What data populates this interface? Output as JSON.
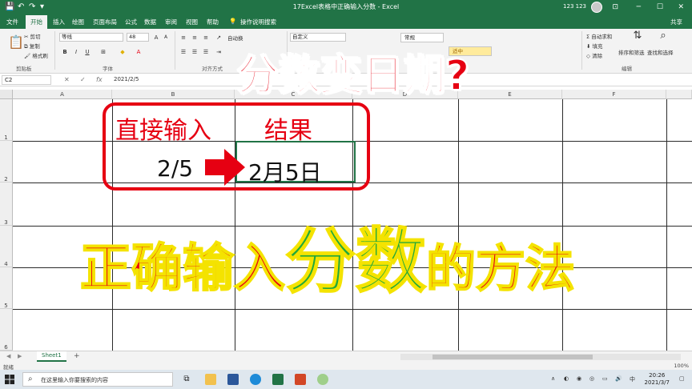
{
  "window": {
    "title": "17Excel表格中正确输入分数 - Excel",
    "user": "123 123"
  },
  "menu": {
    "tabs": [
      "文件",
      "开始",
      "插入",
      "绘图",
      "页面布局",
      "公式",
      "数据",
      "审阅",
      "视图",
      "帮助"
    ],
    "active": "开始",
    "tell_me": "操作说明搜索",
    "share": "共享"
  },
  "ribbon": {
    "clipboard": {
      "cut": "剪切",
      "copy": "复制",
      "format_painter": "格式刷",
      "label": "剪贴板"
    },
    "font": {
      "name": "等线",
      "size": "48",
      "label": "字体"
    },
    "alignment": {
      "wrap": "自动换",
      "label": "对齐方式"
    },
    "number": {
      "format": "自定义"
    },
    "styles": {
      "normal": "常规",
      "neutral": "适中"
    },
    "editing": {
      "autosum": "自动求和",
      "fill": "填充",
      "clear": "清除",
      "sort_filter": "排序和筛选",
      "find_select": "查找和选择",
      "label": "编辑"
    }
  },
  "formula_bar": {
    "name_box": "C2",
    "fx": "fx",
    "content": "2021/2/5"
  },
  "grid": {
    "columns": [
      "A",
      "B",
      "C",
      "D",
      "E",
      "F"
    ],
    "rows": [
      "1",
      "2",
      "3",
      "4",
      "5",
      "6"
    ]
  },
  "overlay": {
    "header_left": "直接输入",
    "header_right": "结果",
    "input_value": "2/5",
    "result_value": "2月5日",
    "big_title": "分数变日期?",
    "subtitle": {
      "part1": "正确输入",
      "part2": "分数",
      "part3": "的方法"
    }
  },
  "sheets": {
    "tabs": [
      "Sheet1"
    ],
    "add": "+"
  },
  "status": {
    "ready": "就绪",
    "zoom": "100%"
  },
  "taskbar": {
    "search_placeholder": "在这里输入你要搜索的内容",
    "ime": "中",
    "time": "20:26",
    "date": "2021/3/7"
  },
  "colors": {
    "excel_green": "#217346",
    "red": "#e60012",
    "green": "#22a83a",
    "yellow_outline": "#f4e300"
  }
}
